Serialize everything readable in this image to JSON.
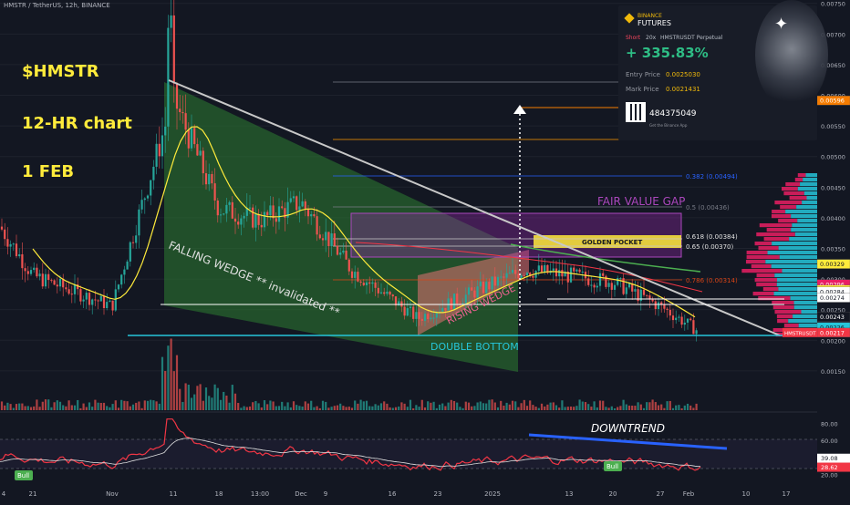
{
  "header": {
    "symbol_line": "HMSTR / TetherUS, 12h, BINANCE"
  },
  "overlay_text": {
    "ticker": "$HMSTR",
    "timeframe": "12-HR chart",
    "date": "1 FEB"
  },
  "binance_card": {
    "brand_small": "BINANCE",
    "brand": "FUTURES",
    "side": "Short",
    "leverage": "20x",
    "contract": "HMSTRUSDT Perpetual",
    "pnl": "+ 335.83%",
    "entry_label": "Entry Price",
    "entry_value": "0.0025030",
    "mark_label": "Mark Price",
    "mark_value": "0.0021431",
    "ref_code": "484375049",
    "ref_hint": "Get the Binance App"
  },
  "annotations": {
    "falling_wedge": "FALLING WEDGE ** invalidated **",
    "rising_wedge": "RISING WEDGE",
    "double_bottom": "DOUBLE BOTTOM",
    "fvg": "FAIR VALUE GAP",
    "golden_pocket": "GOLDEN POCKET",
    "fib_618": "0.618 (0.00384)",
    "fib_65": "0.65 (0.00370)",
    "fib_786": "0.786 (0.00314)",
    "fib_5": "0.5 (0.00436)",
    "fib_382": "0.382 (0.00494)",
    "downtrend": "DOWNTREND",
    "bull1": "Bull",
    "bull2": "Bull"
  },
  "price_axis": {
    "ticks": [
      "0.00750",
      "0.00700",
      "0.00650",
      "0.00600",
      "0.00550",
      "0.00500",
      "0.00450",
      "0.00400",
      "0.00350",
      "0.00300",
      "0.00250",
      "0.00200",
      "0.00150"
    ],
    "badges": [
      {
        "value": "0.00596",
        "color": "#f57c00"
      },
      {
        "value": "0.00329",
        "color": "#ffeb3b"
      },
      {
        "value": "0.00296",
        "color": "#e91e63"
      },
      {
        "value": "0.00287",
        "color": "#ffeb3b"
      },
      {
        "value": "0.00284",
        "color": "#ffffff"
      },
      {
        "value": "0.00274",
        "color": "#ffffff"
      },
      {
        "value": "0.00243",
        "color": "#131722"
      },
      {
        "value": "0.00226",
        "color": "#26c6da"
      },
      {
        "value": "0.00217",
        "color": "#f23645"
      }
    ],
    "symbol_badge": "HMSTRUSDT"
  },
  "rsi_axis": {
    "ticks": [
      "80.00",
      "60.00",
      "40.00",
      "20.00"
    ],
    "rsi_value": "39.08",
    "rsi_ma_value": "28.62"
  },
  "time_axis": [
    "4",
    "21",
    "Nov",
    "11",
    "18",
    "13:00",
    "Dec",
    "9",
    "16",
    "23",
    "2025",
    "13",
    "20",
    "27",
    "Feb",
    "10",
    "17"
  ],
  "chart_data": {
    "type": "line",
    "title": "",
    "series": [
      {
        "name": "",
        "x": [
          "Oct 4",
          "Oct 21",
          "Nov 1",
          "Nov 11",
          "Nov 18",
          "Nov 25",
          "Dec 1",
          "Dec 9",
          "Dec 16",
          "Dec 23",
          "Jan 1",
          "Jan 13",
          "Jan 20",
          "Jan 27",
          "Feb 1"
        ],
        "values": [
          0.0039,
          0.0031,
          0.0026,
          0.006,
          0.0042,
          0.004,
          0.0043,
          0.0032,
          0.0024,
          0.0027,
          0.0032,
          0.0031,
          0.003,
          0.0026,
          0.0022
        ]
      }
    ],
    "ylim": [
      0.0012,
      0.0076
    ],
    "rsi": {
      "ylim": [
        10,
        90
      ],
      "levels": [
        80,
        60,
        40,
        20
      ]
    }
  },
  "colors": {
    "bg": "#131722",
    "up": "#26a69a",
    "down": "#ef5350",
    "accent": "#ffeb3b"
  }
}
